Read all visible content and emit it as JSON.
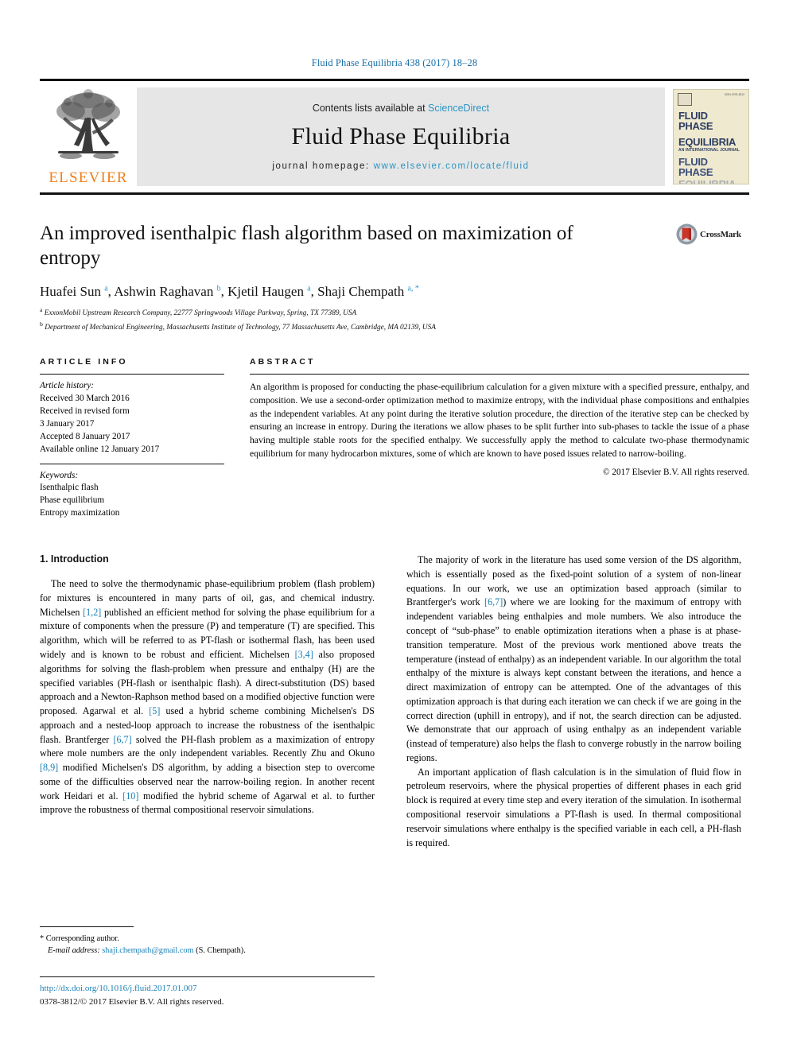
{
  "running_head": "Fluid Phase Equilibria 438 (2017) 18–28",
  "masthead": {
    "publisher_logo_name": "elsevier-tree-logo",
    "publisher_name": "ELSEVIER",
    "contents_prefix": "Contents lists available at ",
    "contents_link": "ScienceDirect",
    "journal_name": "Fluid Phase Equilibria",
    "homepage_prefix": "journal homepage: ",
    "homepage_url": "www.elsevier.com/locate/fluid",
    "cover": {
      "issn_small": "ISSN 0378-3812",
      "line1": "FLUID PHASE",
      "line2": "EQUILIBRIA",
      "subtitle": "AN INTERNATIONAL JOURNAL",
      "line3": "FLUID PHASE",
      "line4": "EQUILIBRIA"
    }
  },
  "article": {
    "title": "An improved isenthalpic flash algorithm based on maximization of entropy",
    "crossmark_label": "CrossMark",
    "authors_html": "Huafei Sun <sup>a</sup>, Ashwin Raghavan <sup>b</sup>, Kjetil Haugen <sup>a</sup>, Shaji Chempath <sup>a, *</sup>",
    "affiliation_a": "ExxonMobil Upstream Research Company, 22777 Springwoods Village Parkway, Spring, TX 77389, USA",
    "affiliation_b": "Department of Mechanical Engineering, Massachusetts Institute of Technology, 77 Massachusetts Ave, Cambridge, MA 02139, USA"
  },
  "article_info": {
    "heading": "ARTICLE INFO",
    "history_label": "Article history:",
    "history": [
      "Received 30 March 2016",
      "Received in revised form",
      "3 January 2017",
      "Accepted 8 January 2017",
      "Available online 12 January 2017"
    ],
    "keywords_label": "Keywords:",
    "keywords": [
      "Isenthalpic flash",
      "Phase equilibrium",
      "Entropy maximization"
    ]
  },
  "abstract": {
    "heading": "ABSTRACT",
    "text": "An algorithm is proposed for conducting the phase-equilibrium calculation for a given mixture with a specified pressure, enthalpy, and composition. We use a second-order optimization method to maximize entropy, with the individual phase compositions and enthalpies as the independent variables. At any point during the iterative solution procedure, the direction of the iterative step can be checked by ensuring an increase in entropy. During the iterations we allow phases to be split further into sub-phases to tackle the issue of a phase having multiple stable roots for the specified enthalpy. We successfully apply the method to calculate two-phase thermodynamic equilibrium for many hydrocarbon mixtures, some of which are known to have posed issues related to narrow-boiling.",
    "copyright": "© 2017 Elsevier B.V. All rights reserved."
  },
  "body": {
    "section_number_title": "1. Introduction",
    "left_paragraphs": [
      "The need to solve the thermodynamic phase-equilibrium problem (flash problem) for mixtures is encountered in many parts of oil, gas, and chemical industry. Michelsen [1,2] published an efficient method for solving the phase equilibrium for a mixture of components when the pressure (P) and temperature (T) are specified. This algorithm, which will be referred to as PT-flash or isothermal flash, has been used widely and is known to be robust and efficient. Michelsen [3,4] also proposed algorithms for solving the flash-problem when pressure and enthalpy (H) are the specified variables (PH-flash or isenthalpic flash). A direct-substitution (DS) based approach and a Newton-Raphson method based on a modified objective function were proposed. Agarwal et al. [5] used a hybrid scheme combining Michelsen's DS approach and a nested-loop approach to increase the robustness of the isenthalpic flash. Brantferger [6,7] solved the PH-flash problem as a maximization of entropy where mole numbers are the only independent variables. Recently Zhu and Okuno [8,9] modified Michelsen's DS algorithm, by adding a bisection step to overcome some of the difficulties observed near the narrow-boiling region. In another recent work Heidari et al. [10] modified the hybrid scheme of Agarwal et al. to further improve the robustness of thermal compositional reservoir simulations."
    ],
    "right_paragraphs": [
      "The majority of work in the literature has used some version of the DS algorithm, which is essentially posed as the fixed-point solution of a system of non-linear equations. In our work, we use an optimization based approach (similar to Brantferger's work [6,7]) where we are looking for the maximum of entropy with independent variables being enthalpies and mole numbers. We also introduce the concept of “sub-phase” to enable optimization iterations when a phase is at phase-transition temperature. Most of the previous work mentioned above treats the temperature (instead of enthalpy) as an independent variable. In our algorithm the total enthalpy of the mixture is always kept constant between the iterations, and hence a direct maximization of entropy can be attempted. One of the advantages of this optimization approach is that during each iteration we can check if we are going in the correct direction (uphill in entropy), and if not, the search direction can be adjusted. We demonstrate that our approach of using enthalpy as an independent variable (instead of temperature) also helps the flash to converge robustly in the narrow boiling regions.",
      "An important application of flash calculation is in the simulation of fluid flow in petroleum reservoirs, where the physical properties of different phases in each grid block is required at every time step and every iteration of the simulation. In isothermal compositional reservoir simulations a PT-flash is used. In thermal compositional reservoir simulations where enthalpy is the specified variable in each cell, a PH-flash is required."
    ]
  },
  "footer": {
    "corresponding_marker": "*",
    "corresponding_text": "Corresponding author.",
    "email_label": "E-mail address:",
    "email": "shaji.chempath@gmail.com",
    "email_suffix": "(S. Chempath).",
    "doi": "http://dx.doi.org/10.1016/j.fluid.2017.01.007",
    "issn_line": "0378-3812/© 2017 Elsevier B.V. All rights reserved."
  },
  "colors": {
    "link_blue": "#1a7fb5",
    "sciencedirect_blue": "#2a95c5",
    "elsevier_orange": "#F07F1A",
    "banner_grey": "#e6e6e6",
    "cover_cream": "#efe9cf",
    "cover_navy": "#2c3d63"
  }
}
